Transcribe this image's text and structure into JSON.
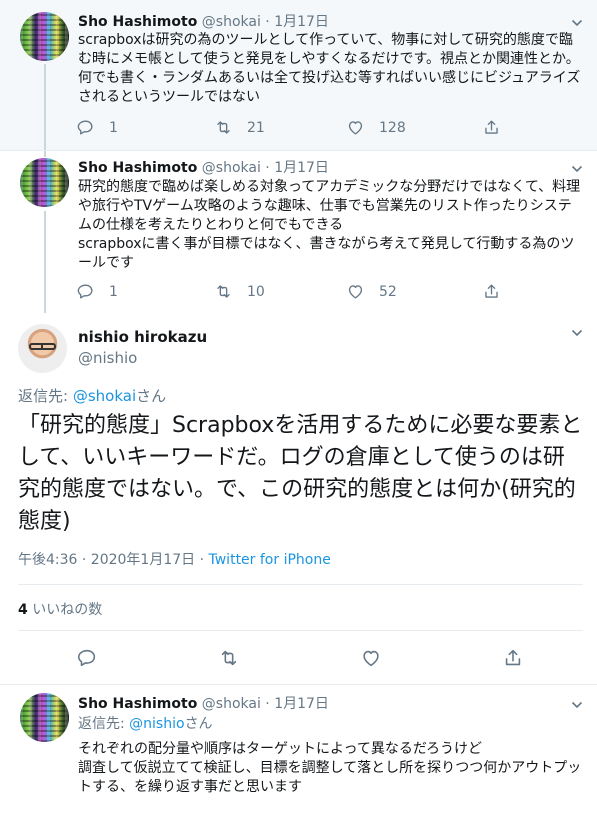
{
  "tweets": [
    {
      "name": "Sho Hashimoto",
      "handle": "@shokai",
      "date": "· 1月17日",
      "text": "scrapboxは研究の為のツールとして作っていて、物事に対して研究的態度で臨む時にメモ帳として使うと発見をしやすくなるだけです。視点とか関連性とか。何でも書く・ランダムあるいは全て投げ込む等すればいい感じにビジュアライズされるというツールではない",
      "replies": "1",
      "retweets": "21",
      "likes": "128"
    },
    {
      "name": "Sho Hashimoto",
      "handle": "@shokai",
      "date": "· 1月17日",
      "text": "研究的態度で臨めば楽しめる対象ってアカデミックな分野だけではなくて、料理や旅行やTVゲーム攻略のような趣味、仕事でも営業先のリスト作ったりシステムの仕様を考えたりとわりと何でもできる\nscrapboxに書く事が目標ではなく、書きながら考えて発見して行動する為のツールです",
      "replies": "1",
      "retweets": "10",
      "likes": "52"
    }
  ],
  "main": {
    "name": "nishio hirokazu",
    "handle": "@nishio",
    "reply_prefix": "返信先: ",
    "reply_handle": "@shokai",
    "reply_suffix": "さん",
    "text": "「研究的態度」Scrapboxを活用するために必要な要素として、いいキーワードだ。ログの倉庫として使うのは研究的態度ではない。で、この研究的態度とは何か(研究的態度)",
    "time": "午後4:36 · 2020年1月17日 · ",
    "source": "Twitter for iPhone",
    "likes_count": "4",
    "likes_label": " いいねの数"
  },
  "reply": {
    "name": "Sho Hashimoto",
    "handle": "@shokai",
    "date": "· 1月17日",
    "reply_prefix": "返信先: ",
    "reply_handle": "@nishio",
    "reply_suffix": "さん",
    "text": "それぞれの配分量や順序はターゲットによって異なるだろうけど\n調査して仮説立てて検証し、目標を調整して落とし所を探りつつ何かアウトプットする、を繰り返す事だと思います"
  },
  "icons": {
    "reply": "reply-icon",
    "retweet": "retweet-icon",
    "like": "heart-icon",
    "share": "share-icon",
    "caret": "chevron-down-icon"
  },
  "colors": {
    "link": "#1b95e0",
    "muted": "#657786",
    "highlight_bg": "#f5f8fa",
    "divider": "#e6ecf0"
  }
}
